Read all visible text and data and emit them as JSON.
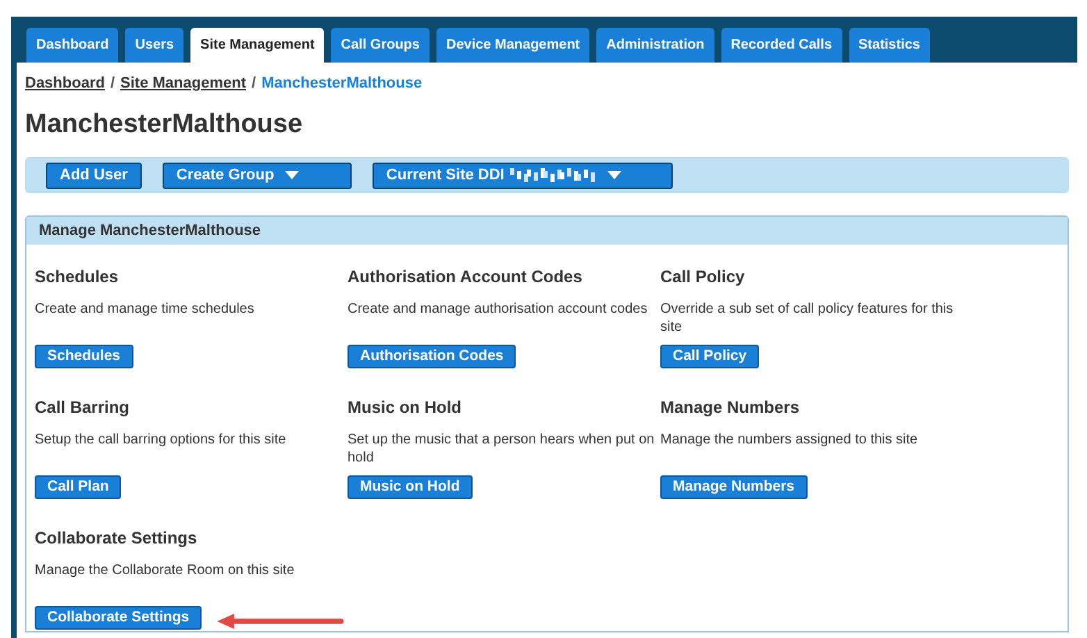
{
  "tabs": [
    {
      "label": "Dashboard",
      "selected": false
    },
    {
      "label": "Users",
      "selected": false
    },
    {
      "label": "Site Management",
      "selected": true
    },
    {
      "label": "Call Groups",
      "selected": false
    },
    {
      "label": "Device Management",
      "selected": false
    },
    {
      "label": "Administration",
      "selected": false
    },
    {
      "label": "Recorded Calls",
      "selected": false
    },
    {
      "label": "Statistics",
      "selected": false
    }
  ],
  "breadcrumb": [
    {
      "label": "Dashboard",
      "current": false
    },
    {
      "label": "Site Management",
      "current": false
    },
    {
      "label": "ManchesterMalthouse",
      "current": true
    }
  ],
  "breadcrumb_separator": "/",
  "title": "ManchesterMalthouse",
  "toolbar": [
    {
      "label": "Add User",
      "dropdown": false,
      "redacted": false
    },
    {
      "label": "Create Group",
      "dropdown": true,
      "redacted": false
    },
    {
      "label": "Current Site DDI",
      "dropdown": true,
      "redacted": true
    }
  ],
  "panel": {
    "title": "Manage ManchesterMalthouse",
    "sections": [
      {
        "heading": "Schedules",
        "description": "Create and manage time schedules",
        "button": "Schedules",
        "highlighted": false
      },
      {
        "heading": "Authorisation Account Codes",
        "description": "Create and manage authorisation account codes",
        "button": "Authorisation Codes",
        "highlighted": false
      },
      {
        "heading": "Call Policy",
        "description": "Override a sub set of call policy features for this site",
        "button": "Call Policy",
        "highlighted": false
      },
      {
        "heading": "Call Barring",
        "description": "Setup the call barring options for this site",
        "button": "Call Plan",
        "highlighted": false
      },
      {
        "heading": "Music on Hold",
        "description": "Set up the music that a person hears when put on hold",
        "button": "Music on Hold",
        "highlighted": false
      },
      {
        "heading": "Manage Numbers",
        "description": "Manage the numbers assigned to this site",
        "button": "Manage Numbers",
        "highlighted": false
      },
      {
        "heading": "Collaborate Settings",
        "description": "Manage the Collaborate Room on this site",
        "button": "Collaborate Settings",
        "highlighted": true
      }
    ]
  }
}
